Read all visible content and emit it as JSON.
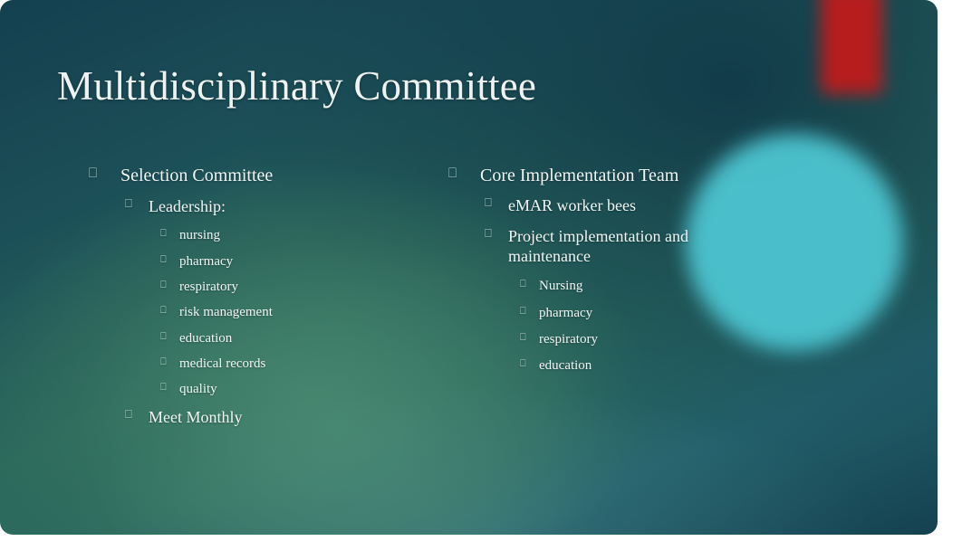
{
  "slide": {
    "title": "Multidisciplinary Committee",
    "bullet_glyph": "⎕",
    "colors": {
      "background_dark_teal": "#14404f",
      "background_green": "#2c6a5c",
      "accent_red": "#c01b1b",
      "accent_cyan": "#4cc3cf",
      "text": "#f1f5f4",
      "bullet": "#bcd6d2"
    }
  },
  "left_column": {
    "heading": "Selection Committee",
    "subheading": "Leadership:",
    "members": [
      "nursing",
      "pharmacy",
      "respiratory",
      "risk management",
      "education",
      "medical records",
      "quality"
    ],
    "cadence": "Meet Monthly"
  },
  "right_column": {
    "heading": "Core Implementation Team",
    "items": [
      "eMAR worker bees",
      "Project implementation and maintenance"
    ],
    "members": [
      "Nursing",
      "pharmacy",
      "respiratory",
      "education"
    ]
  }
}
